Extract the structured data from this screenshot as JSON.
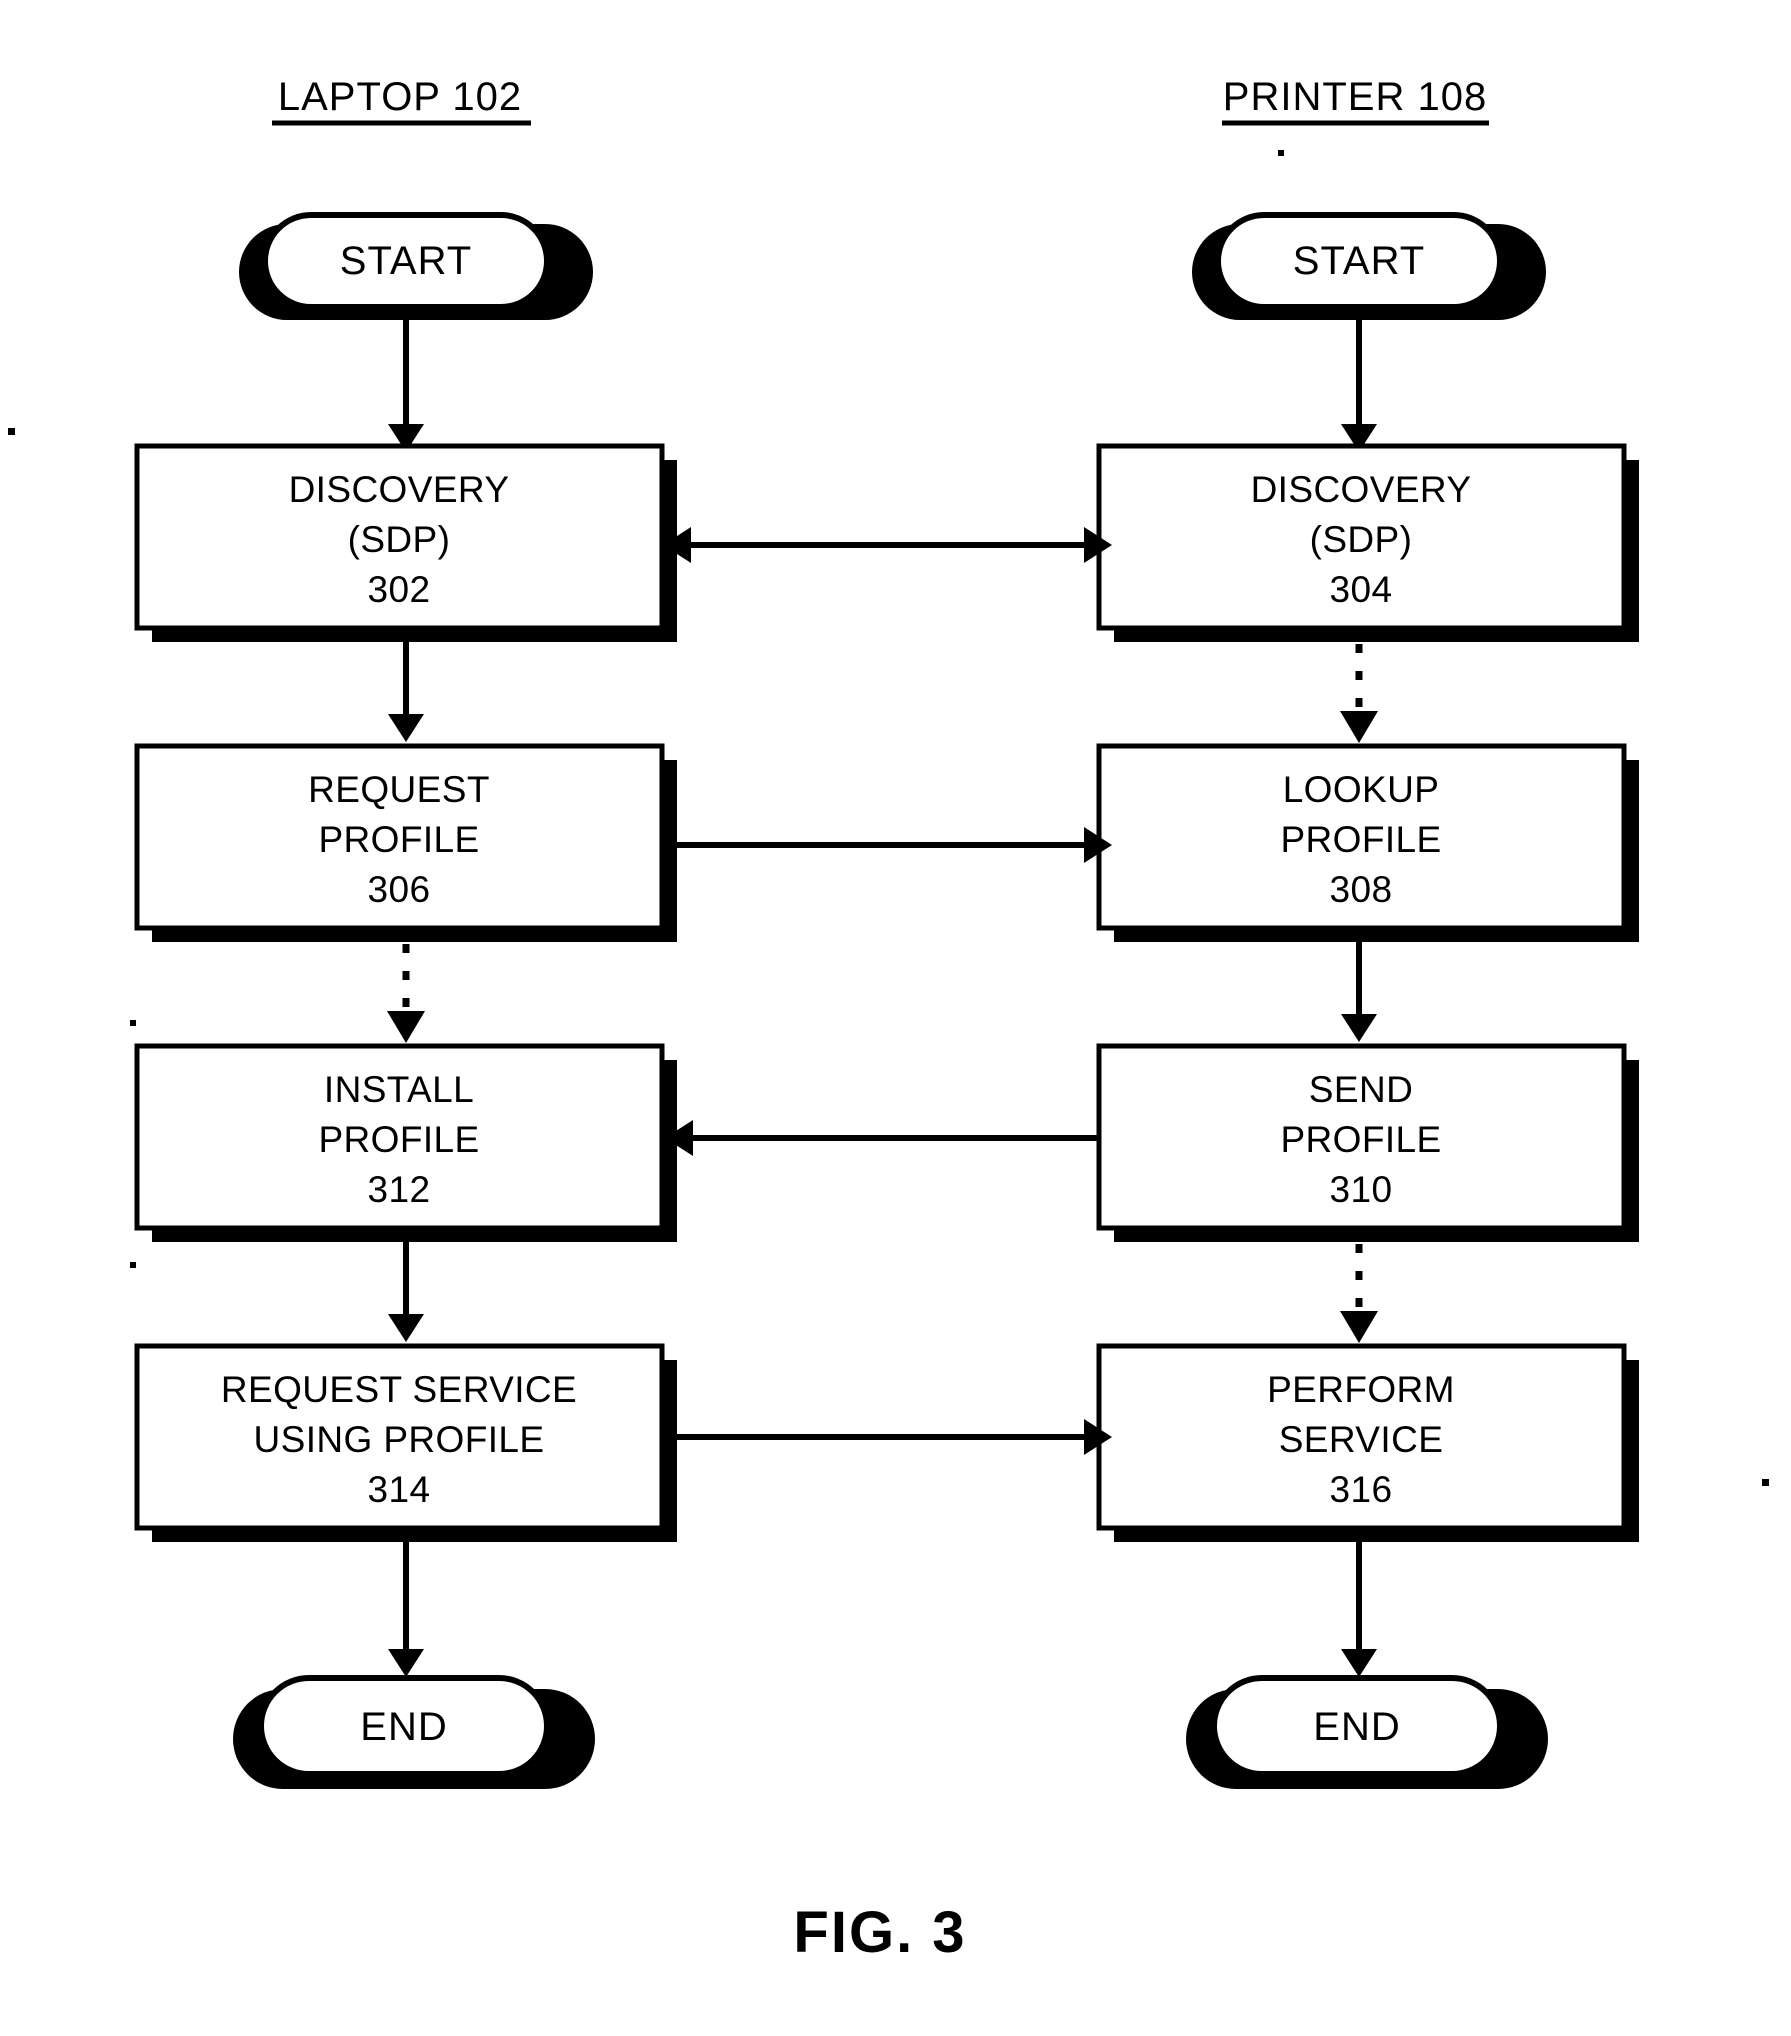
{
  "figure": {
    "caption": "FIG. 3",
    "columns": [
      {
        "id": "laptop",
        "label": "LAPTOP  102"
      },
      {
        "id": "printer",
        "label": "PRINTER  108"
      }
    ]
  },
  "laptop_column": {
    "start": {
      "label": "START"
    },
    "end": {
      "label": "END"
    },
    "steps": [
      {
        "line1": "DISCOVERY",
        "line2": "(SDP)",
        "ref": "302"
      },
      {
        "line1": "REQUEST",
        "line2": "PROFILE",
        "ref": "306"
      },
      {
        "line1": "INSTALL",
        "line2": "PROFILE",
        "ref": "312"
      },
      {
        "line1": "REQUEST SERVICE",
        "line2": "USING PROFILE",
        "ref": "314"
      }
    ]
  },
  "printer_column": {
    "start": {
      "label": "START"
    },
    "end": {
      "label": "END"
    },
    "steps": [
      {
        "line1": "DISCOVERY",
        "line2": "(SDP)",
        "ref": "304"
      },
      {
        "line1": "LOOKUP",
        "line2": "PROFILE",
        "ref": "308"
      },
      {
        "line1": "SEND",
        "line2": "PROFILE",
        "ref": "310"
      },
      {
        "line1": "PERFORM",
        "line2": "SERVICE",
        "ref": "316"
      }
    ]
  },
  "connections": [
    {
      "id": "laptop-start-to-302",
      "style": "solid",
      "direction": "down"
    },
    {
      "id": "printer-start-to-304",
      "style": "solid",
      "direction": "down"
    },
    {
      "id": "302-to-304-bidirectional",
      "style": "solid",
      "direction": "bidirectional"
    },
    {
      "id": "302-to-306",
      "style": "solid",
      "direction": "down"
    },
    {
      "id": "304-to-308",
      "style": "dashed",
      "direction": "down"
    },
    {
      "id": "306-to-308",
      "style": "solid",
      "direction": "right"
    },
    {
      "id": "306-to-312",
      "style": "dashed",
      "direction": "down"
    },
    {
      "id": "308-to-310",
      "style": "solid",
      "direction": "down"
    },
    {
      "id": "310-to-312",
      "style": "solid",
      "direction": "left"
    },
    {
      "id": "312-to-314",
      "style": "solid",
      "direction": "down"
    },
    {
      "id": "310-to-316",
      "style": "dashed",
      "direction": "down"
    },
    {
      "id": "314-to-316",
      "style": "solid",
      "direction": "right"
    },
    {
      "id": "314-to-laptop-end",
      "style": "solid",
      "direction": "down"
    },
    {
      "id": "316-to-printer-end",
      "style": "solid",
      "direction": "down"
    }
  ],
  "style": {
    "line_color": "#000000",
    "fill_color": "#ffffff",
    "background": "#ffffff"
  }
}
